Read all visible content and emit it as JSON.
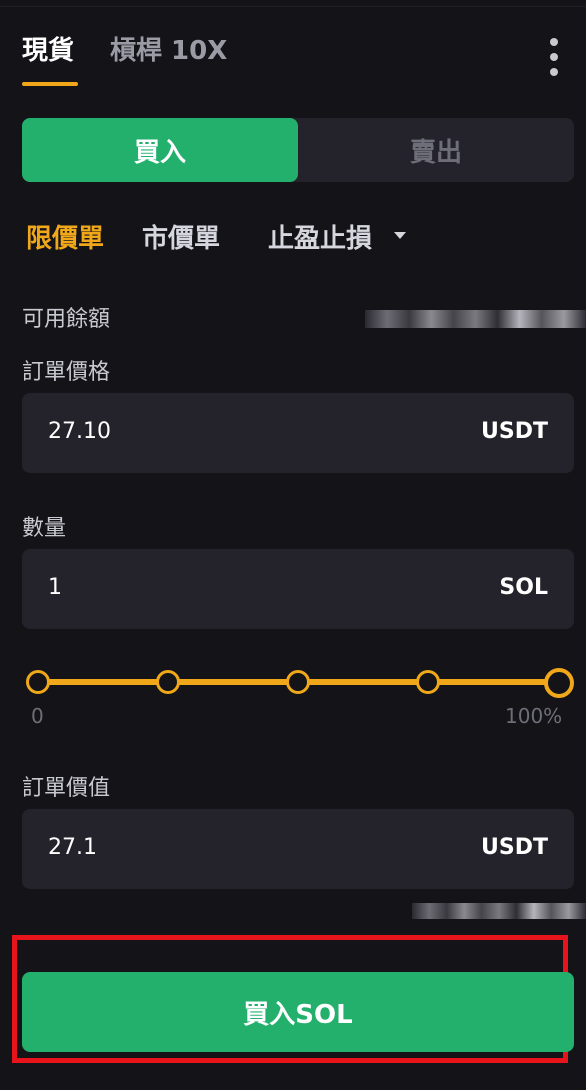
{
  "tabs": {
    "spot": "現貨",
    "margin": "槓桿 10X"
  },
  "side": {
    "buy": "買入",
    "sell": "賣出"
  },
  "order_types": {
    "limit": "限價單",
    "market": "市價單",
    "stop": "止盈止損"
  },
  "balance": {
    "label": "可用餘額"
  },
  "price": {
    "label": "訂單價格",
    "value": "27.10",
    "unit": "USDT"
  },
  "amount": {
    "label": "數量",
    "value": "1",
    "unit": "SOL"
  },
  "slider": {
    "min_label": "0",
    "max_label": "100%",
    "level_percent": 100
  },
  "total": {
    "label": "訂單價值",
    "value": "27.1",
    "unit": "USDT"
  },
  "submit": {
    "label": "買入SOL"
  },
  "icons": {
    "more": "more-vertical-icon",
    "dropdown": "caret-down-icon"
  },
  "colors": {
    "buy": "#22b06c",
    "accent": "#f0a81a",
    "highlight": "#e8141c",
    "background": "#141318"
  }
}
